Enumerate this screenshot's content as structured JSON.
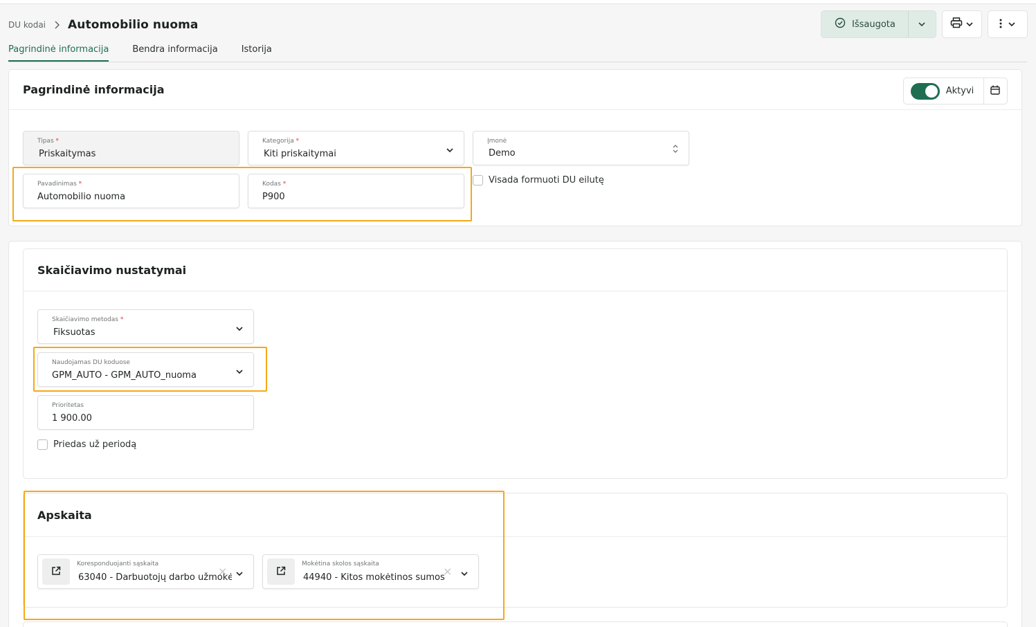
{
  "header": {
    "breadcrumb_parent": "DU kodai",
    "title": "Automobilio nuoma",
    "save_label": "Išsaugota"
  },
  "tabs": [
    {
      "label": "Pagrindinė informacija",
      "active": true
    },
    {
      "label": "Bendra informacija",
      "active": false
    },
    {
      "label": "Istorija",
      "active": false
    }
  ],
  "main_info": {
    "title": "Pagrindinė informacija",
    "active_label": "Aktyvi",
    "active_state": true,
    "tipas": {
      "label": "Tipas",
      "value": "Priskaitymas"
    },
    "kategorija": {
      "label": "Kategorija",
      "value": "Kiti priskaitymai"
    },
    "imone": {
      "label": "Įmonė",
      "value": "Demo"
    },
    "pavadinimas": {
      "label": "Pavadinimas",
      "value": "Automobilio nuoma"
    },
    "kodas": {
      "label": "Kodas",
      "value": "P900"
    },
    "always_du_label": "Visada formuoti DU eilutę",
    "always_du_checked": false
  },
  "calc": {
    "title": "Skaičiavimo nustatymai",
    "metodas": {
      "label": "Skaičiavimo metodas",
      "value": "Fiksuotas"
    },
    "naudojamas": {
      "label": "Naudojamas DU koduose",
      "value": "GPM_AUTO - GPM_AUTO_nuoma"
    },
    "prioritetas": {
      "label": "Prioritetas",
      "value": "1 900.00"
    },
    "priedas_label": "Priedas už periodą",
    "priedas_checked": false
  },
  "accounting": {
    "title": "Apskaita",
    "korespondent": {
      "label": "Koresponduojanti sąskaita",
      "value": "63040 - Darbuotojų darbo užmokė"
    },
    "moketina": {
      "label": "Mokėtina skolos sąskaita",
      "value": "44940 - Kitos mokėtinos sumos"
    }
  },
  "colors": {
    "accent": "#1f6e52",
    "highlight": "#f5a817",
    "required": "#d43b3b"
  },
  "icons": [
    "chevron-right-icon",
    "check-circle-icon",
    "chevron-down-icon",
    "printer-icon",
    "kebab-icon",
    "calendar-icon",
    "sort-icon",
    "external-link-icon",
    "clear-icon"
  ]
}
